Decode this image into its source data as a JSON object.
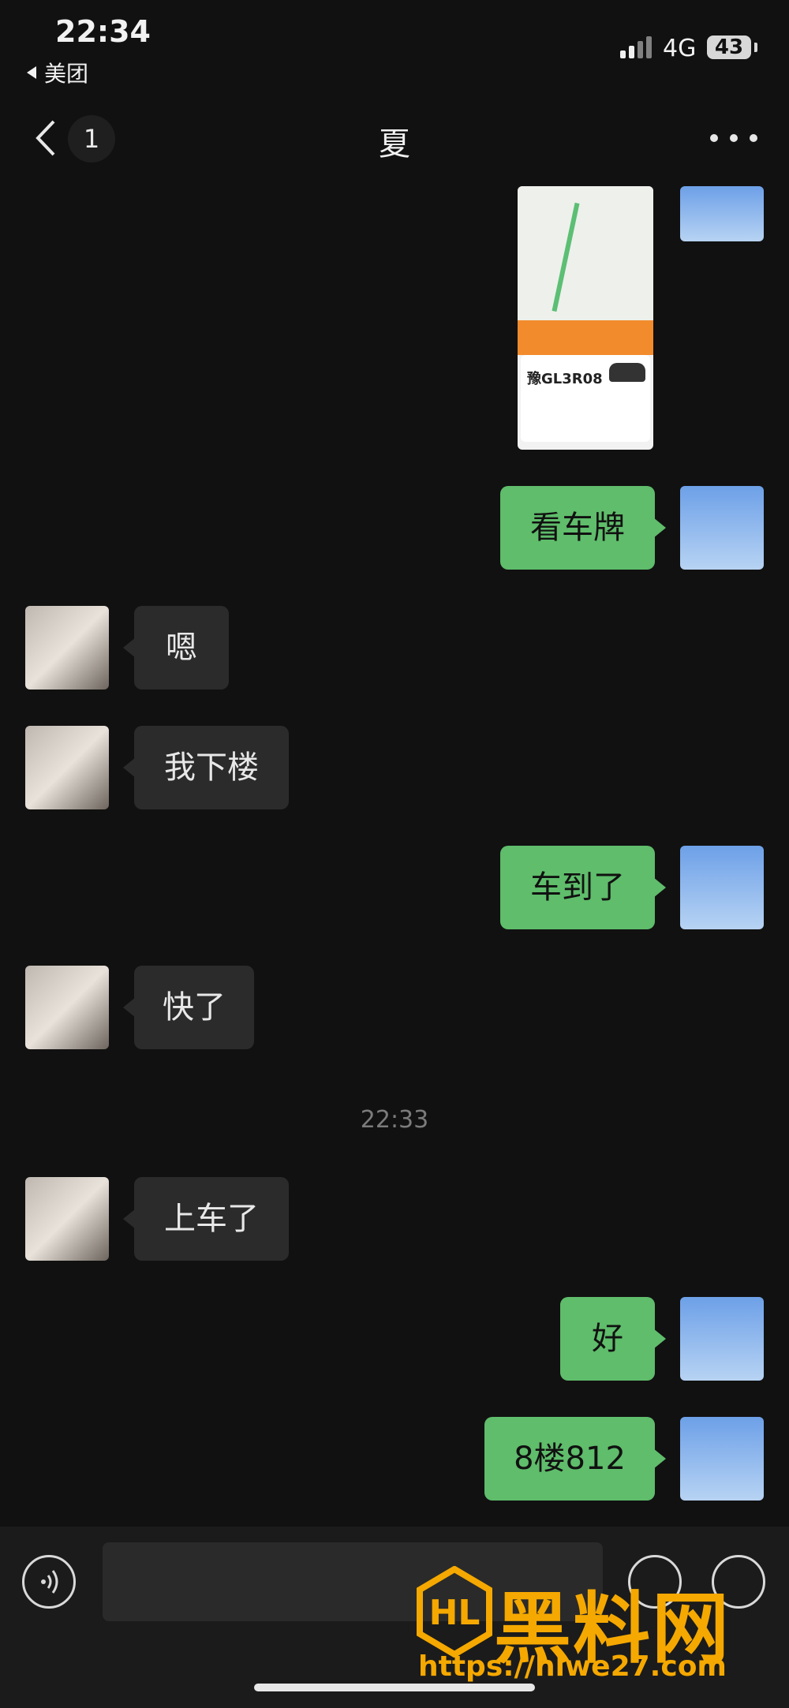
{
  "status_bar": {
    "time": "22:34",
    "back_app": "美团",
    "network": "4G",
    "battery": "43"
  },
  "nav": {
    "unread_count": "1",
    "title": "夏"
  },
  "messages": [
    {
      "side": "right",
      "type": "image",
      "plate": "豫GL3R08"
    },
    {
      "side": "right",
      "text": "看车牌"
    },
    {
      "side": "left",
      "text": "嗯"
    },
    {
      "side": "left",
      "text": "我下楼"
    },
    {
      "side": "right",
      "text": "车到了"
    },
    {
      "side": "left",
      "text": "快了"
    },
    {
      "side": "left",
      "text": "上车了"
    },
    {
      "side": "right",
      "text": "好"
    },
    {
      "side": "right",
      "text": "8楼812"
    }
  ],
  "timestamp": "22:33",
  "watermark": {
    "name": "黑料网",
    "url": "https://hlwe27.com"
  },
  "colors": {
    "background": "#111111",
    "outgoing_bubble": "#5fbd6b",
    "incoming_bubble": "#2b2b2b",
    "watermark": "#f5a800"
  }
}
